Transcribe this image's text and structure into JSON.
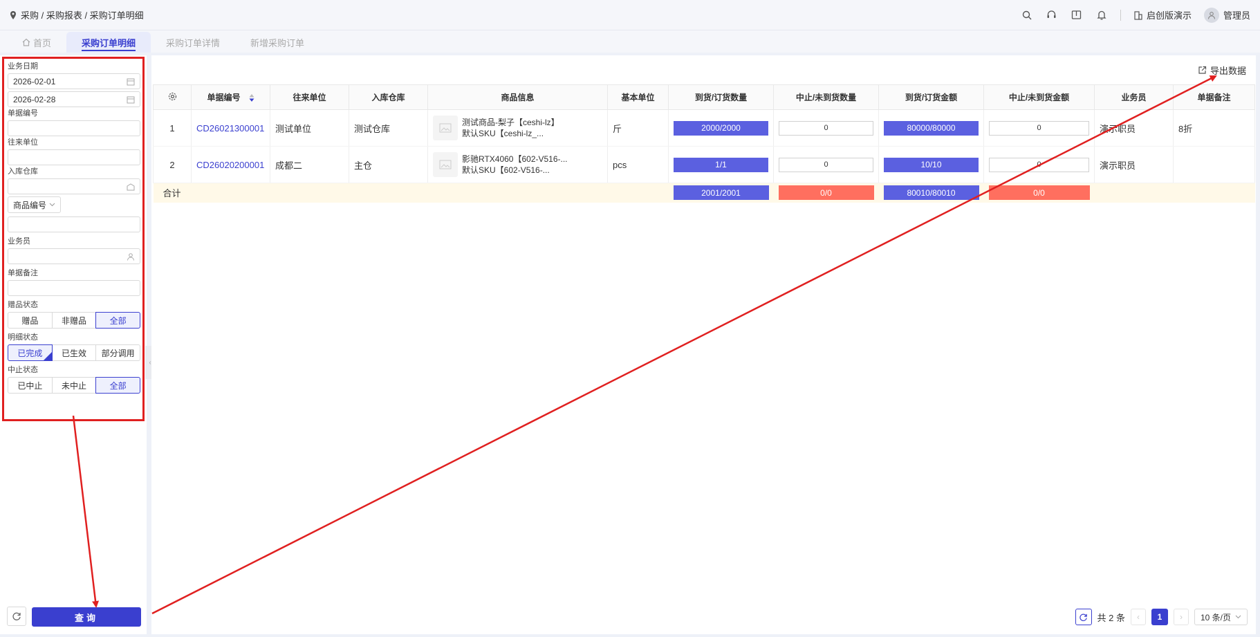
{
  "breadcrumb": "采购 / 采购报表 / 采购订单明细",
  "header": {
    "company": "启创版演示",
    "user": "管理员"
  },
  "tabs": [
    {
      "label": "首页"
    },
    {
      "label": "采购订单明细"
    },
    {
      "label": "采购订单详情"
    },
    {
      "label": "新增采购订单"
    }
  ],
  "filters": {
    "date_label": "业务日期",
    "date_start": "2026-02-01",
    "date_end": "2026-02-28",
    "order_no_label": "单据编号",
    "partner_label": "往来单位",
    "warehouse_label": "入库仓库",
    "product_select": "商品编号",
    "salesman_label": "业务员",
    "remark_label": "单据备注",
    "gift_label": "赠品状态",
    "gift_options": [
      "赠品",
      "非赠品",
      "全部"
    ],
    "detail_label": "明细状态",
    "detail_options": [
      "已完成",
      "已生效",
      "部分调用"
    ],
    "stop_label": "中止状态",
    "stop_options": [
      "已中止",
      "未中止",
      "全部"
    ],
    "query_button": "查询"
  },
  "export_label": "导出数据",
  "table": {
    "columns": [
      "单据编号",
      "往来单位",
      "入库仓库",
      "商品信息",
      "基本单位",
      "到货/订货数量",
      "中止/未到货数量",
      "到货/订货金额",
      "中止/未到货金额",
      "业务员",
      "单据备注"
    ],
    "rows": [
      {
        "idx": "1",
        "order_no": "CD26021300001",
        "partner": "测试单位",
        "warehouse": "测试仓库",
        "product_line1": "测试商品-梨子【ceshi-lz】",
        "product_line2": "默认SKU【ceshi-lz_...",
        "unit": "斤",
        "qty": "2000/2000",
        "stop_qty": "0",
        "amount": "80000/80000",
        "stop_amount": "0",
        "salesman": "演示职员",
        "remark": "8折"
      },
      {
        "idx": "2",
        "order_no": "CD26020200001",
        "partner": "成都二",
        "warehouse": "主仓",
        "product_line1": "影驰RTX4060【602-V516-...",
        "product_line2": "默认SKU【602-V516-...",
        "unit": "pcs",
        "qty": "1/1",
        "stop_qty": "0",
        "amount": "10/10",
        "stop_amount": "0",
        "salesman": "演示职员",
        "remark": ""
      }
    ],
    "summary": {
      "label": "合计",
      "qty": "2001/2001",
      "stop_qty": "0/0",
      "amount": "80010/80010",
      "stop_amount": "0/0"
    }
  },
  "pagination": {
    "total": "共 2 条",
    "current": "1",
    "page_size": "10 条/页"
  },
  "colors": {
    "accent": "#3a3fcf",
    "bar": "#5b60e0",
    "bar_red": "#ff6f5f",
    "annotation": "#e02020"
  }
}
